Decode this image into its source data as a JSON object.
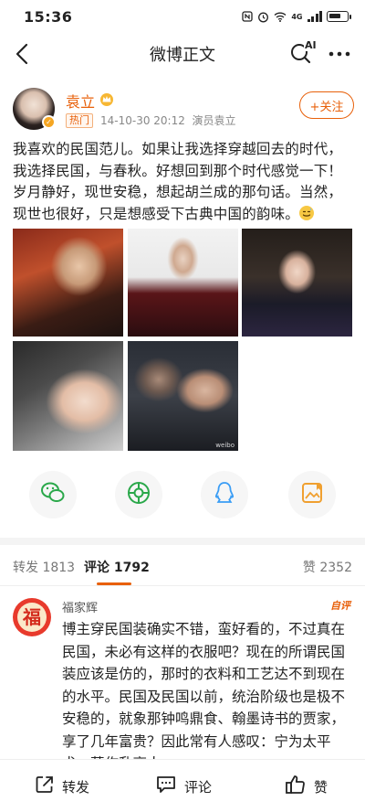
{
  "status": {
    "time": "15:36",
    "network": "4G",
    "battery": ""
  },
  "nav": {
    "title": "微博正文",
    "ai_label": "AI"
  },
  "author": {
    "name": "袁立",
    "hot_tag": "热门",
    "time": "14-10-30 20:12",
    "source": "演员袁立",
    "follow_label": "+关注"
  },
  "post": {
    "text": "我喜欢的民国范儿。如果让我选择穿越回去的时代，我选择民国，与春秋。好想回到那个时代感觉一下！岁月静好，现世安稳，想起胡兰成的那句话。当然，现世也很好，只是想感受下古典中国的韵味。",
    "emoji": "sweat-smile-emoji",
    "watermark": "weibo"
  },
  "share": [
    {
      "name": "wechat",
      "icon": "wechat-icon"
    },
    {
      "name": "moments",
      "icon": "moments-icon"
    },
    {
      "name": "qq",
      "icon": "qq-icon"
    },
    {
      "name": "save-image",
      "icon": "image-save-icon"
    }
  ],
  "tabs": {
    "repost": "转发 1813",
    "comments": "评论 1792",
    "likes": "赞 2352"
  },
  "comment": {
    "user": "福家辉",
    "avatar_char": "福",
    "badge": "自评",
    "text": "博主穿民国装确实不错，蛮好看的，不过真在民国，未必有这样的衣服吧？现在的所谓民国装应该是仿的，那时的衣料和工艺达不到现在的水平。民国及民国以前，统治阶级也是极不安稳的，就象那钟鸣鼎食、翰墨诗书的贾家，享了几年富贵？因此常有人感叹：宁为太平犬，莫作乱离人。"
  },
  "bottom": {
    "repost": "转发",
    "comment": "评论",
    "like": "赞"
  },
  "colors": {
    "accent": "#e8600a",
    "text": "#222222",
    "muted": "#888888"
  }
}
